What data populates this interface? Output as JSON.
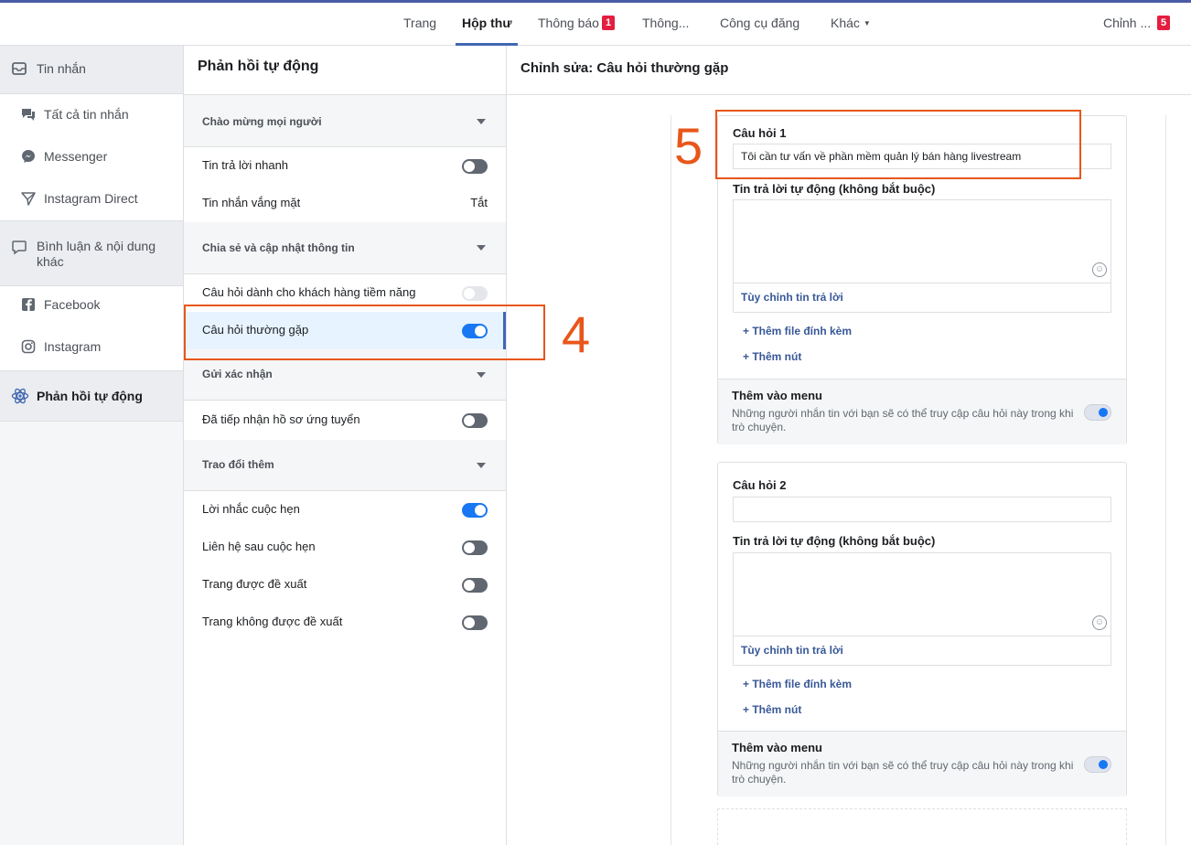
{
  "topnav": {
    "tabs": [
      {
        "label": "Trang"
      },
      {
        "label": "Hộp thư"
      },
      {
        "label": "Thông báo",
        "badge": "1"
      },
      {
        "label": "Thông..."
      },
      {
        "label": "Công cụ đăng"
      },
      {
        "label": "Khác"
      }
    ],
    "edit": {
      "label": "Chỉnh ...",
      "badge": "5"
    }
  },
  "sidebar": {
    "messages": {
      "label": "Tin nhắn",
      "icon": "inbox-icon"
    },
    "all_messages": {
      "label": "Tất cả tin nhắn",
      "icon": "chat-bubbles-icon"
    },
    "messenger": {
      "label": "Messenger",
      "icon": "messenger-icon"
    },
    "instagram_direct": {
      "label": "Instagram Direct",
      "icon": "send-icon"
    },
    "comments": {
      "label": "Bình luận & nội dung khác",
      "icon": "comment-icon"
    },
    "facebook": {
      "label": "Facebook",
      "icon": "facebook-icon"
    },
    "instagram": {
      "label": "Instagram",
      "icon": "instagram-icon"
    },
    "auto_reply": {
      "label": "Phản hồi tự động",
      "icon": "atom-icon"
    }
  },
  "middle": {
    "title": "Phản hồi tự động",
    "sections": [
      {
        "title": "Chào mừng mọi người",
        "rows": [
          {
            "label": "Tin trả lời nhanh",
            "state": "off"
          },
          {
            "label": "Tin nhắn vắng mặt",
            "value": "Tắt"
          }
        ]
      },
      {
        "title": "Chia sẻ và cập nhật thông tin",
        "rows": [
          {
            "label": "Câu hỏi dành cho khách hàng tiềm năng",
            "state": "disabled"
          },
          {
            "label": "Câu hỏi thường gặp",
            "state": "on",
            "selected": true
          }
        ]
      },
      {
        "title": "Gửi xác nhận",
        "rows": [
          {
            "label": "Đã tiếp nhận hồ sơ ứng tuyển",
            "state": "off"
          }
        ]
      },
      {
        "title": "Trao đổi thêm",
        "rows": [
          {
            "label": "Lời nhắc cuộc hẹn",
            "state": "on"
          },
          {
            "label": "Liên hệ sau cuộc hẹn",
            "state": "off"
          },
          {
            "label": "Trang được đề xuất",
            "state": "off"
          },
          {
            "label": "Trang không được đề xuất",
            "state": "off"
          }
        ]
      }
    ]
  },
  "right": {
    "title": "Chỉnh sửa: Câu hỏi thường gặp",
    "questions": [
      {
        "label": "Câu hỏi 1",
        "value": "Tôi cần tư vấn về phần mềm quản lý bán hàng livestream",
        "answer_label": "Tin trả lời tự động (không bắt buộc)",
        "customize": "Tùy chỉnh tin trả lời",
        "add_attachment": "+ Thêm file đính kèm",
        "add_button": "+ Thêm nút",
        "menu_title": "Thêm vào menu",
        "menu_desc": "Những người nhắn tin với bạn sẽ có thể truy cập câu hỏi này trong khi trò chuyện."
      },
      {
        "label": "Câu hỏi 2",
        "value": "",
        "answer_label": "Tin trả lời tự động (không bắt buộc)",
        "customize": "Tùy chỉnh tin trả lời",
        "add_attachment": "+ Thêm file đính kèm",
        "add_button": "+ Thêm nút",
        "menu_title": "Thêm vào menu",
        "menu_desc": "Những người nhắn tin với bạn sẽ có thể truy cập câu hỏi này trong khi trò chuyện."
      }
    ]
  },
  "annotations": {
    "step4": "4",
    "step5": "5",
    "color": "#e8561a"
  },
  "colors": {
    "accent": "#4267b2",
    "toggle_on": "#1877f2",
    "link": "#385898",
    "badge": "#e41e3f"
  }
}
